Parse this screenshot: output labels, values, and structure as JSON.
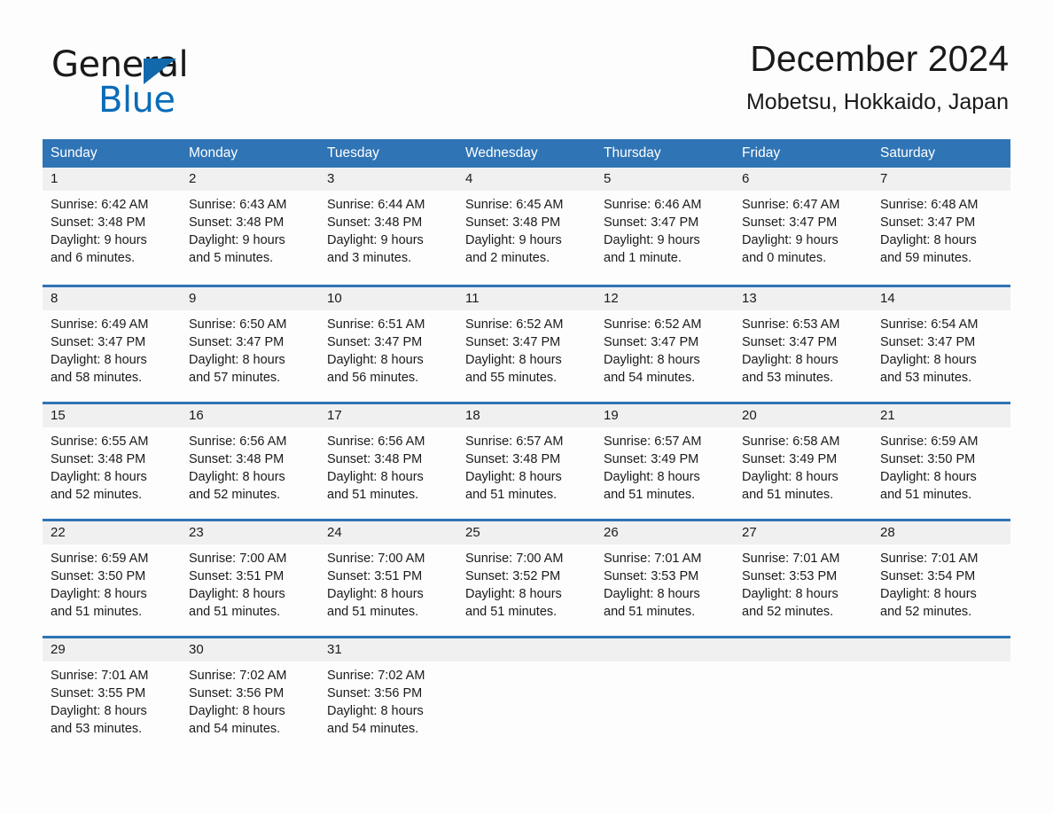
{
  "brand": {
    "name_part1": "General",
    "name_part2": "Blue",
    "triangle_color": "#1168ab",
    "blue_color": "#0a6cb8"
  },
  "header": {
    "title": "December 2024",
    "subtitle": "Mobetsu, Hokkaido, Japan"
  },
  "theme": {
    "header_bg": "#2f74b5",
    "day_band_bg": "#f0f0f0",
    "page_bg": "#fdfdfd"
  },
  "weekdays": [
    "Sunday",
    "Monday",
    "Tuesday",
    "Wednesday",
    "Thursday",
    "Friday",
    "Saturday"
  ],
  "weeks": [
    [
      {
        "day": "1",
        "sunrise": "Sunrise: 6:42 AM",
        "sunset": "Sunset: 3:48 PM",
        "daylight_line1": "Daylight: 9 hours",
        "daylight_line2": "and 6 minutes."
      },
      {
        "day": "2",
        "sunrise": "Sunrise: 6:43 AM",
        "sunset": "Sunset: 3:48 PM",
        "daylight_line1": "Daylight: 9 hours",
        "daylight_line2": "and 5 minutes."
      },
      {
        "day": "3",
        "sunrise": "Sunrise: 6:44 AM",
        "sunset": "Sunset: 3:48 PM",
        "daylight_line1": "Daylight: 9 hours",
        "daylight_line2": "and 3 minutes."
      },
      {
        "day": "4",
        "sunrise": "Sunrise: 6:45 AM",
        "sunset": "Sunset: 3:48 PM",
        "daylight_line1": "Daylight: 9 hours",
        "daylight_line2": "and 2 minutes."
      },
      {
        "day": "5",
        "sunrise": "Sunrise: 6:46 AM",
        "sunset": "Sunset: 3:47 PM",
        "daylight_line1": "Daylight: 9 hours",
        "daylight_line2": "and 1 minute."
      },
      {
        "day": "6",
        "sunrise": "Sunrise: 6:47 AM",
        "sunset": "Sunset: 3:47 PM",
        "daylight_line1": "Daylight: 9 hours",
        "daylight_line2": "and 0 minutes."
      },
      {
        "day": "7",
        "sunrise": "Sunrise: 6:48 AM",
        "sunset": "Sunset: 3:47 PM",
        "daylight_line1": "Daylight: 8 hours",
        "daylight_line2": "and 59 minutes."
      }
    ],
    [
      {
        "day": "8",
        "sunrise": "Sunrise: 6:49 AM",
        "sunset": "Sunset: 3:47 PM",
        "daylight_line1": "Daylight: 8 hours",
        "daylight_line2": "and 58 minutes."
      },
      {
        "day": "9",
        "sunrise": "Sunrise: 6:50 AM",
        "sunset": "Sunset: 3:47 PM",
        "daylight_line1": "Daylight: 8 hours",
        "daylight_line2": "and 57 minutes."
      },
      {
        "day": "10",
        "sunrise": "Sunrise: 6:51 AM",
        "sunset": "Sunset: 3:47 PM",
        "daylight_line1": "Daylight: 8 hours",
        "daylight_line2": "and 56 minutes."
      },
      {
        "day": "11",
        "sunrise": "Sunrise: 6:52 AM",
        "sunset": "Sunset: 3:47 PM",
        "daylight_line1": "Daylight: 8 hours",
        "daylight_line2": "and 55 minutes."
      },
      {
        "day": "12",
        "sunrise": "Sunrise: 6:52 AM",
        "sunset": "Sunset: 3:47 PM",
        "daylight_line1": "Daylight: 8 hours",
        "daylight_line2": "and 54 minutes."
      },
      {
        "day": "13",
        "sunrise": "Sunrise: 6:53 AM",
        "sunset": "Sunset: 3:47 PM",
        "daylight_line1": "Daylight: 8 hours",
        "daylight_line2": "and 53 minutes."
      },
      {
        "day": "14",
        "sunrise": "Sunrise: 6:54 AM",
        "sunset": "Sunset: 3:47 PM",
        "daylight_line1": "Daylight: 8 hours",
        "daylight_line2": "and 53 minutes."
      }
    ],
    [
      {
        "day": "15",
        "sunrise": "Sunrise: 6:55 AM",
        "sunset": "Sunset: 3:48 PM",
        "daylight_line1": "Daylight: 8 hours",
        "daylight_line2": "and 52 minutes."
      },
      {
        "day": "16",
        "sunrise": "Sunrise: 6:56 AM",
        "sunset": "Sunset: 3:48 PM",
        "daylight_line1": "Daylight: 8 hours",
        "daylight_line2": "and 52 minutes."
      },
      {
        "day": "17",
        "sunrise": "Sunrise: 6:56 AM",
        "sunset": "Sunset: 3:48 PM",
        "daylight_line1": "Daylight: 8 hours",
        "daylight_line2": "and 51 minutes."
      },
      {
        "day": "18",
        "sunrise": "Sunrise: 6:57 AM",
        "sunset": "Sunset: 3:48 PM",
        "daylight_line1": "Daylight: 8 hours",
        "daylight_line2": "and 51 minutes."
      },
      {
        "day": "19",
        "sunrise": "Sunrise: 6:57 AM",
        "sunset": "Sunset: 3:49 PM",
        "daylight_line1": "Daylight: 8 hours",
        "daylight_line2": "and 51 minutes."
      },
      {
        "day": "20",
        "sunrise": "Sunrise: 6:58 AM",
        "sunset": "Sunset: 3:49 PM",
        "daylight_line1": "Daylight: 8 hours",
        "daylight_line2": "and 51 minutes."
      },
      {
        "day": "21",
        "sunrise": "Sunrise: 6:59 AM",
        "sunset": "Sunset: 3:50 PM",
        "daylight_line1": "Daylight: 8 hours",
        "daylight_line2": "and 51 minutes."
      }
    ],
    [
      {
        "day": "22",
        "sunrise": "Sunrise: 6:59 AM",
        "sunset": "Sunset: 3:50 PM",
        "daylight_line1": "Daylight: 8 hours",
        "daylight_line2": "and 51 minutes."
      },
      {
        "day": "23",
        "sunrise": "Sunrise: 7:00 AM",
        "sunset": "Sunset: 3:51 PM",
        "daylight_line1": "Daylight: 8 hours",
        "daylight_line2": "and 51 minutes."
      },
      {
        "day": "24",
        "sunrise": "Sunrise: 7:00 AM",
        "sunset": "Sunset: 3:51 PM",
        "daylight_line1": "Daylight: 8 hours",
        "daylight_line2": "and 51 minutes."
      },
      {
        "day": "25",
        "sunrise": "Sunrise: 7:00 AM",
        "sunset": "Sunset: 3:52 PM",
        "daylight_line1": "Daylight: 8 hours",
        "daylight_line2": "and 51 minutes."
      },
      {
        "day": "26",
        "sunrise": "Sunrise: 7:01 AM",
        "sunset": "Sunset: 3:53 PM",
        "daylight_line1": "Daylight: 8 hours",
        "daylight_line2": "and 51 minutes."
      },
      {
        "day": "27",
        "sunrise": "Sunrise: 7:01 AM",
        "sunset": "Sunset: 3:53 PM",
        "daylight_line1": "Daylight: 8 hours",
        "daylight_line2": "and 52 minutes."
      },
      {
        "day": "28",
        "sunrise": "Sunrise: 7:01 AM",
        "sunset": "Sunset: 3:54 PM",
        "daylight_line1": "Daylight: 8 hours",
        "daylight_line2": "and 52 minutes."
      }
    ],
    [
      {
        "day": "29",
        "sunrise": "Sunrise: 7:01 AM",
        "sunset": "Sunset: 3:55 PM",
        "daylight_line1": "Daylight: 8 hours",
        "daylight_line2": "and 53 minutes."
      },
      {
        "day": "30",
        "sunrise": "Sunrise: 7:02 AM",
        "sunset": "Sunset: 3:56 PM",
        "daylight_line1": "Daylight: 8 hours",
        "daylight_line2": "and 54 minutes."
      },
      {
        "day": "31",
        "sunrise": "Sunrise: 7:02 AM",
        "sunset": "Sunset: 3:56 PM",
        "daylight_line1": "Daylight: 8 hours",
        "daylight_line2": "and 54 minutes."
      },
      {
        "day": "",
        "sunrise": "",
        "sunset": "",
        "daylight_line1": "",
        "daylight_line2": ""
      },
      {
        "day": "",
        "sunrise": "",
        "sunset": "",
        "daylight_line1": "",
        "daylight_line2": ""
      },
      {
        "day": "",
        "sunrise": "",
        "sunset": "",
        "daylight_line1": "",
        "daylight_line2": ""
      },
      {
        "day": "",
        "sunrise": "",
        "sunset": "",
        "daylight_line1": "",
        "daylight_line2": ""
      }
    ]
  ]
}
